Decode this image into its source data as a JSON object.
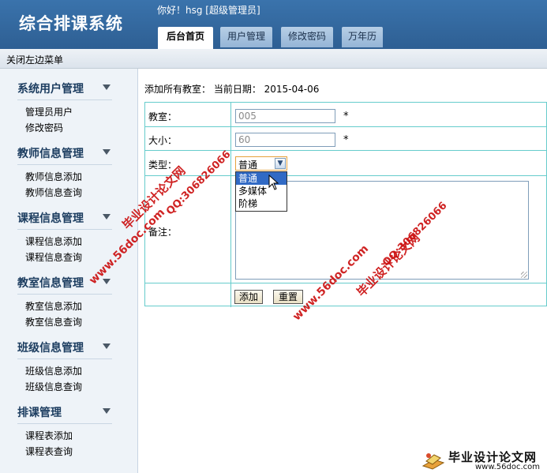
{
  "header": {
    "app_title": "综合排课系统",
    "greeting": "你好！hsg [超级管理员]",
    "tabs": [
      {
        "label": "后台首页",
        "active": true
      },
      {
        "label": "用户管理",
        "active": false
      },
      {
        "label": "修改密码",
        "active": false
      },
      {
        "label": "万年历",
        "active": false
      }
    ]
  },
  "toolbar": {
    "close_menu": "关闭左边菜单"
  },
  "sidebar": {
    "groups": [
      {
        "title": "系统用户管理",
        "items": [
          "管理员用户",
          "修改密码"
        ]
      },
      {
        "title": "教师信息管理",
        "items": [
          "教师信息添加",
          "教师信息查询"
        ]
      },
      {
        "title": "课程信息管理",
        "items": [
          "课程信息添加",
          "课程信息查询"
        ]
      },
      {
        "title": "教室信息管理",
        "items": [
          "教室信息添加",
          "教室信息查询"
        ]
      },
      {
        "title": "班级信息管理",
        "items": [
          "班级信息添加",
          "班级信息查询"
        ]
      },
      {
        "title": "排课管理",
        "items": [
          "课程表添加",
          "课程表查询"
        ]
      }
    ]
  },
  "main": {
    "info_line": "添加所有教室： 当前日期： 2015-04-06",
    "form": {
      "classroom_label": "教室：",
      "classroom_value": "005",
      "size_label": "大小：",
      "size_value": "60",
      "required_mark": "*",
      "type_label": "类型：",
      "type_selected": "普通",
      "type_options": [
        "普通",
        "多媒体",
        "阶梯"
      ],
      "remark_label": "备注：",
      "remark_value": "",
      "add_button": "添加",
      "reset_button": "重置"
    }
  },
  "watermarks": {
    "site_name": "毕业设计论文网",
    "url": "www.56doc.com",
    "qq": "QQ:306826066",
    "logo_name": "毕业设计论文网",
    "logo_url": "www.56doc.com"
  },
  "colors": {
    "header": "#3a73ac",
    "table_border": "#66cccc",
    "sidebar_bg": "#eef3f8",
    "watermark": "#cc1111",
    "selected_option": "#316ac5"
  }
}
